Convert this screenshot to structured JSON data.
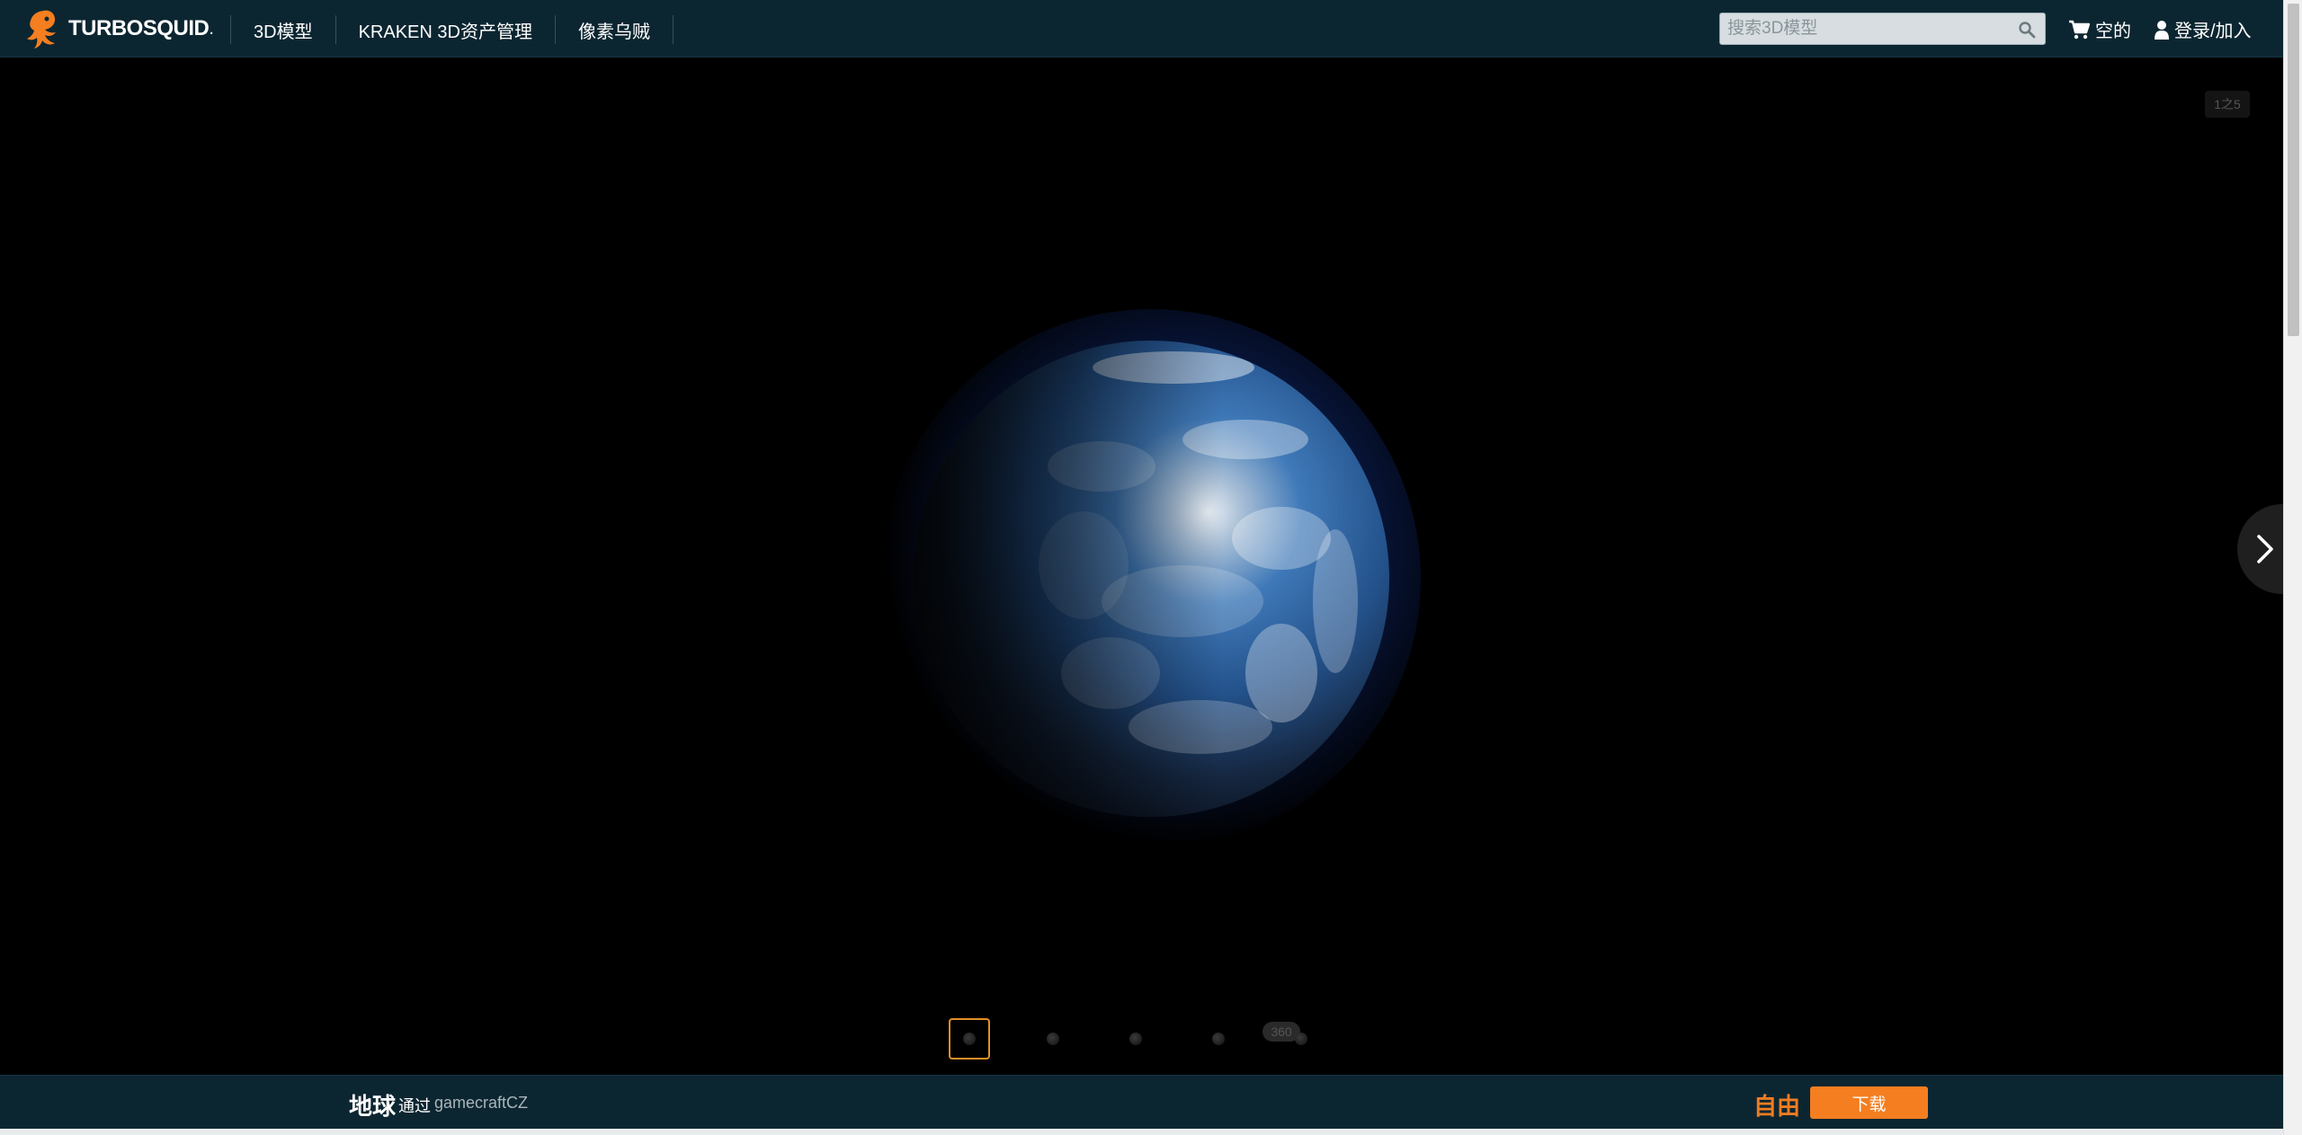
{
  "header": {
    "logo_text": "TURBOSQUID",
    "logo_dot": ".",
    "nav": [
      "3D模型",
      "KRAKEN 3D资产管理",
      "像素乌贼"
    ],
    "search_placeholder": "搜索3D模型",
    "cart_label": "空的",
    "login_label": "登录/加入"
  },
  "viewer": {
    "image_counter": "1之5",
    "badge_360": "360",
    "thumbnail_count": 5,
    "active_thumbnail": 1
  },
  "product": {
    "title": "地球",
    "by_label": "通过",
    "author": "gamecraftCZ",
    "price_label": "自由",
    "download_label": "下载"
  },
  "colors": {
    "nav_bg": "#0c2631",
    "accent_orange": "#f47e20",
    "thumb_active_border": "#e39025"
  }
}
